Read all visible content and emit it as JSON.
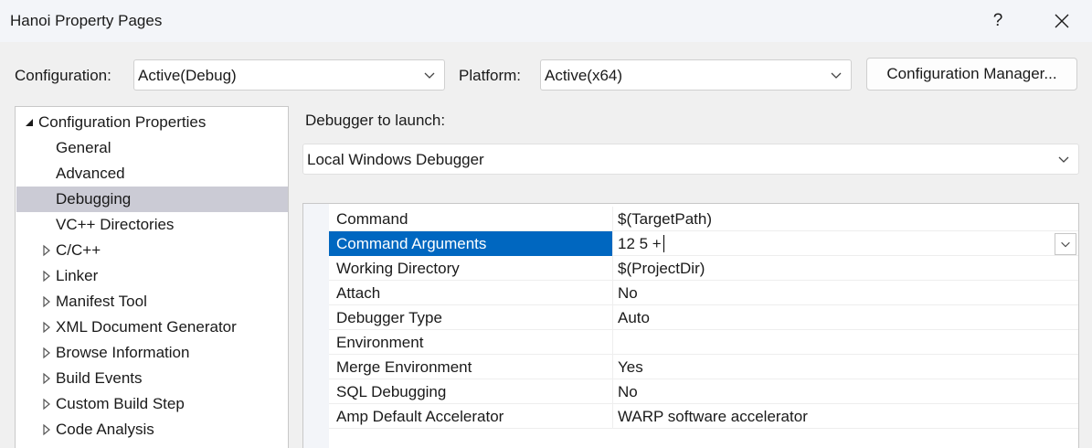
{
  "window": {
    "title": "Hanoi Property Pages",
    "help_label": "?",
    "close_icon": "close-icon"
  },
  "header": {
    "configuration_label": "Configuration:",
    "configuration_value": "Active(Debug)",
    "platform_label": "Platform:",
    "platform_value": "Active(x64)",
    "config_manager_label": "Configuration Manager..."
  },
  "tree": {
    "root": {
      "label": "Configuration Properties",
      "expanded": true
    },
    "children": [
      {
        "label": "General"
      },
      {
        "label": "Advanced"
      },
      {
        "label": "Debugging",
        "selected": true
      },
      {
        "label": "VC++ Directories"
      }
    ],
    "collapsed": [
      {
        "label": "C/C++"
      },
      {
        "label": "Linker"
      },
      {
        "label": "Manifest Tool"
      },
      {
        "label": "XML Document Generator"
      },
      {
        "label": "Browse Information"
      },
      {
        "label": "Build Events"
      },
      {
        "label": "Custom Build Step"
      },
      {
        "label": "Code Analysis"
      }
    ]
  },
  "debugger": {
    "label": "Debugger to launch:",
    "value": "Local Windows Debugger"
  },
  "properties": [
    {
      "name": "Command",
      "value": "$(TargetPath)"
    },
    {
      "name": "Command Arguments",
      "value": "12 5 +",
      "selected": true,
      "editing": true
    },
    {
      "name": "Working Directory",
      "value": "$(ProjectDir)"
    },
    {
      "name": "Attach",
      "value": "No"
    },
    {
      "name": "Debugger Type",
      "value": "Auto"
    },
    {
      "name": "Environment",
      "value": ""
    },
    {
      "name": "Merge Environment",
      "value": "Yes"
    },
    {
      "name": "SQL Debugging",
      "value": "No"
    },
    {
      "name": "Amp Default Accelerator",
      "value": "WARP software accelerator"
    }
  ],
  "colors": {
    "selection_blue": "#0067c0",
    "tree_selection": "#cbcbd5"
  }
}
